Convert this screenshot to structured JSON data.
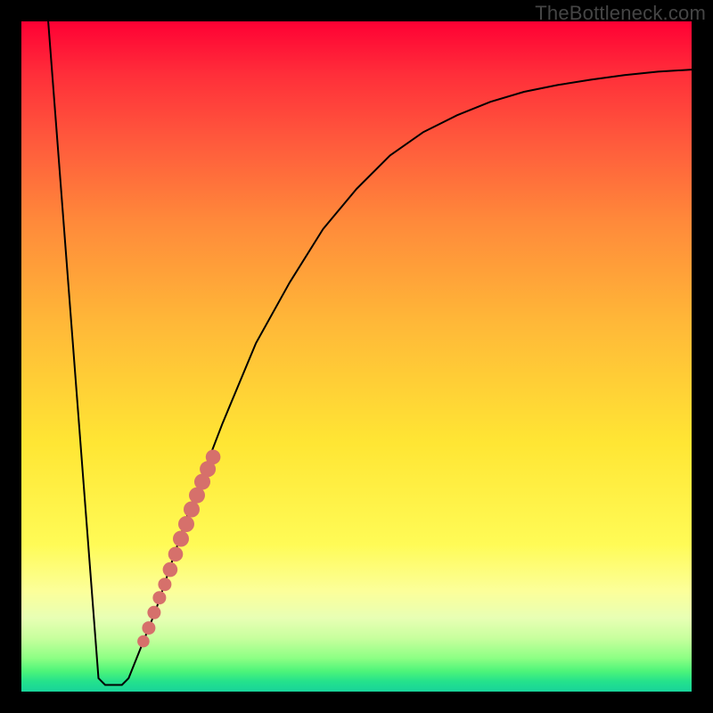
{
  "watermark": "TheBottleneck.com",
  "chart_data": {
    "type": "line",
    "title": "",
    "xlabel": "",
    "ylabel": "",
    "xlim": [
      0,
      100
    ],
    "ylim": [
      0,
      100
    ],
    "gradient_stops": [
      {
        "pos": 0,
        "color": "#ff0034"
      },
      {
        "pos": 8,
        "color": "#ff2f3a"
      },
      {
        "pos": 18,
        "color": "#ff5a3c"
      },
      {
        "pos": 30,
        "color": "#ff8a3a"
      },
      {
        "pos": 45,
        "color": "#ffb838"
      },
      {
        "pos": 63,
        "color": "#ffe634"
      },
      {
        "pos": 78,
        "color": "#fffb56"
      },
      {
        "pos": 85,
        "color": "#fcff9a"
      },
      {
        "pos": 89,
        "color": "#e8ffb4"
      },
      {
        "pos": 92,
        "color": "#c8ff9e"
      },
      {
        "pos": 95,
        "color": "#8dff84"
      },
      {
        "pos": 97,
        "color": "#4cf47a"
      },
      {
        "pos": 98.5,
        "color": "#24e18c"
      },
      {
        "pos": 100,
        "color": "#18d49a"
      }
    ],
    "series": [
      {
        "name": "bottleneck-curve",
        "stroke": "#000000",
        "points": [
          {
            "x": 4.0,
            "y": 100.0
          },
          {
            "x": 11.5,
            "y": 2.0
          },
          {
            "x": 12.5,
            "y": 1.0
          },
          {
            "x": 15.0,
            "y": 1.0
          },
          {
            "x": 16.0,
            "y": 2.0
          },
          {
            "x": 20.0,
            "y": 12.0
          },
          {
            "x": 25.0,
            "y": 27.0
          },
          {
            "x": 30.0,
            "y": 40.0
          },
          {
            "x": 35.0,
            "y": 52.0
          },
          {
            "x": 40.0,
            "y": 61.0
          },
          {
            "x": 45.0,
            "y": 69.0
          },
          {
            "x": 50.0,
            "y": 75.0
          },
          {
            "x": 55.0,
            "y": 80.0
          },
          {
            "x": 60.0,
            "y": 83.5
          },
          {
            "x": 65.0,
            "y": 86.0
          },
          {
            "x": 70.0,
            "y": 88.0
          },
          {
            "x": 75.0,
            "y": 89.5
          },
          {
            "x": 80.0,
            "y": 90.5
          },
          {
            "x": 85.0,
            "y": 91.3
          },
          {
            "x": 90.0,
            "y": 92.0
          },
          {
            "x": 95.0,
            "y": 92.5
          },
          {
            "x": 100.0,
            "y": 92.8
          }
        ]
      }
    ],
    "markers": {
      "name": "cluster-dots",
      "fill": "#d6706b",
      "points": [
        {
          "x": 18.2,
          "y": 7.5,
          "r": 0.9
        },
        {
          "x": 19.0,
          "y": 9.5,
          "r": 1.0
        },
        {
          "x": 19.8,
          "y": 11.8,
          "r": 1.0
        },
        {
          "x": 20.6,
          "y": 14.0,
          "r": 1.0
        },
        {
          "x": 21.4,
          "y": 16.0,
          "r": 1.0
        },
        {
          "x": 22.2,
          "y": 18.2,
          "r": 1.1
        },
        {
          "x": 23.0,
          "y": 20.5,
          "r": 1.1
        },
        {
          "x": 23.8,
          "y": 22.8,
          "r": 1.2
        },
        {
          "x": 24.6,
          "y": 25.0,
          "r": 1.2
        },
        {
          "x": 25.4,
          "y": 27.2,
          "r": 1.2
        },
        {
          "x": 26.2,
          "y": 29.3,
          "r": 1.2
        },
        {
          "x": 27.0,
          "y": 31.3,
          "r": 1.2
        },
        {
          "x": 27.8,
          "y": 33.2,
          "r": 1.2
        },
        {
          "x": 28.6,
          "y": 35.0,
          "r": 1.1
        }
      ]
    }
  }
}
